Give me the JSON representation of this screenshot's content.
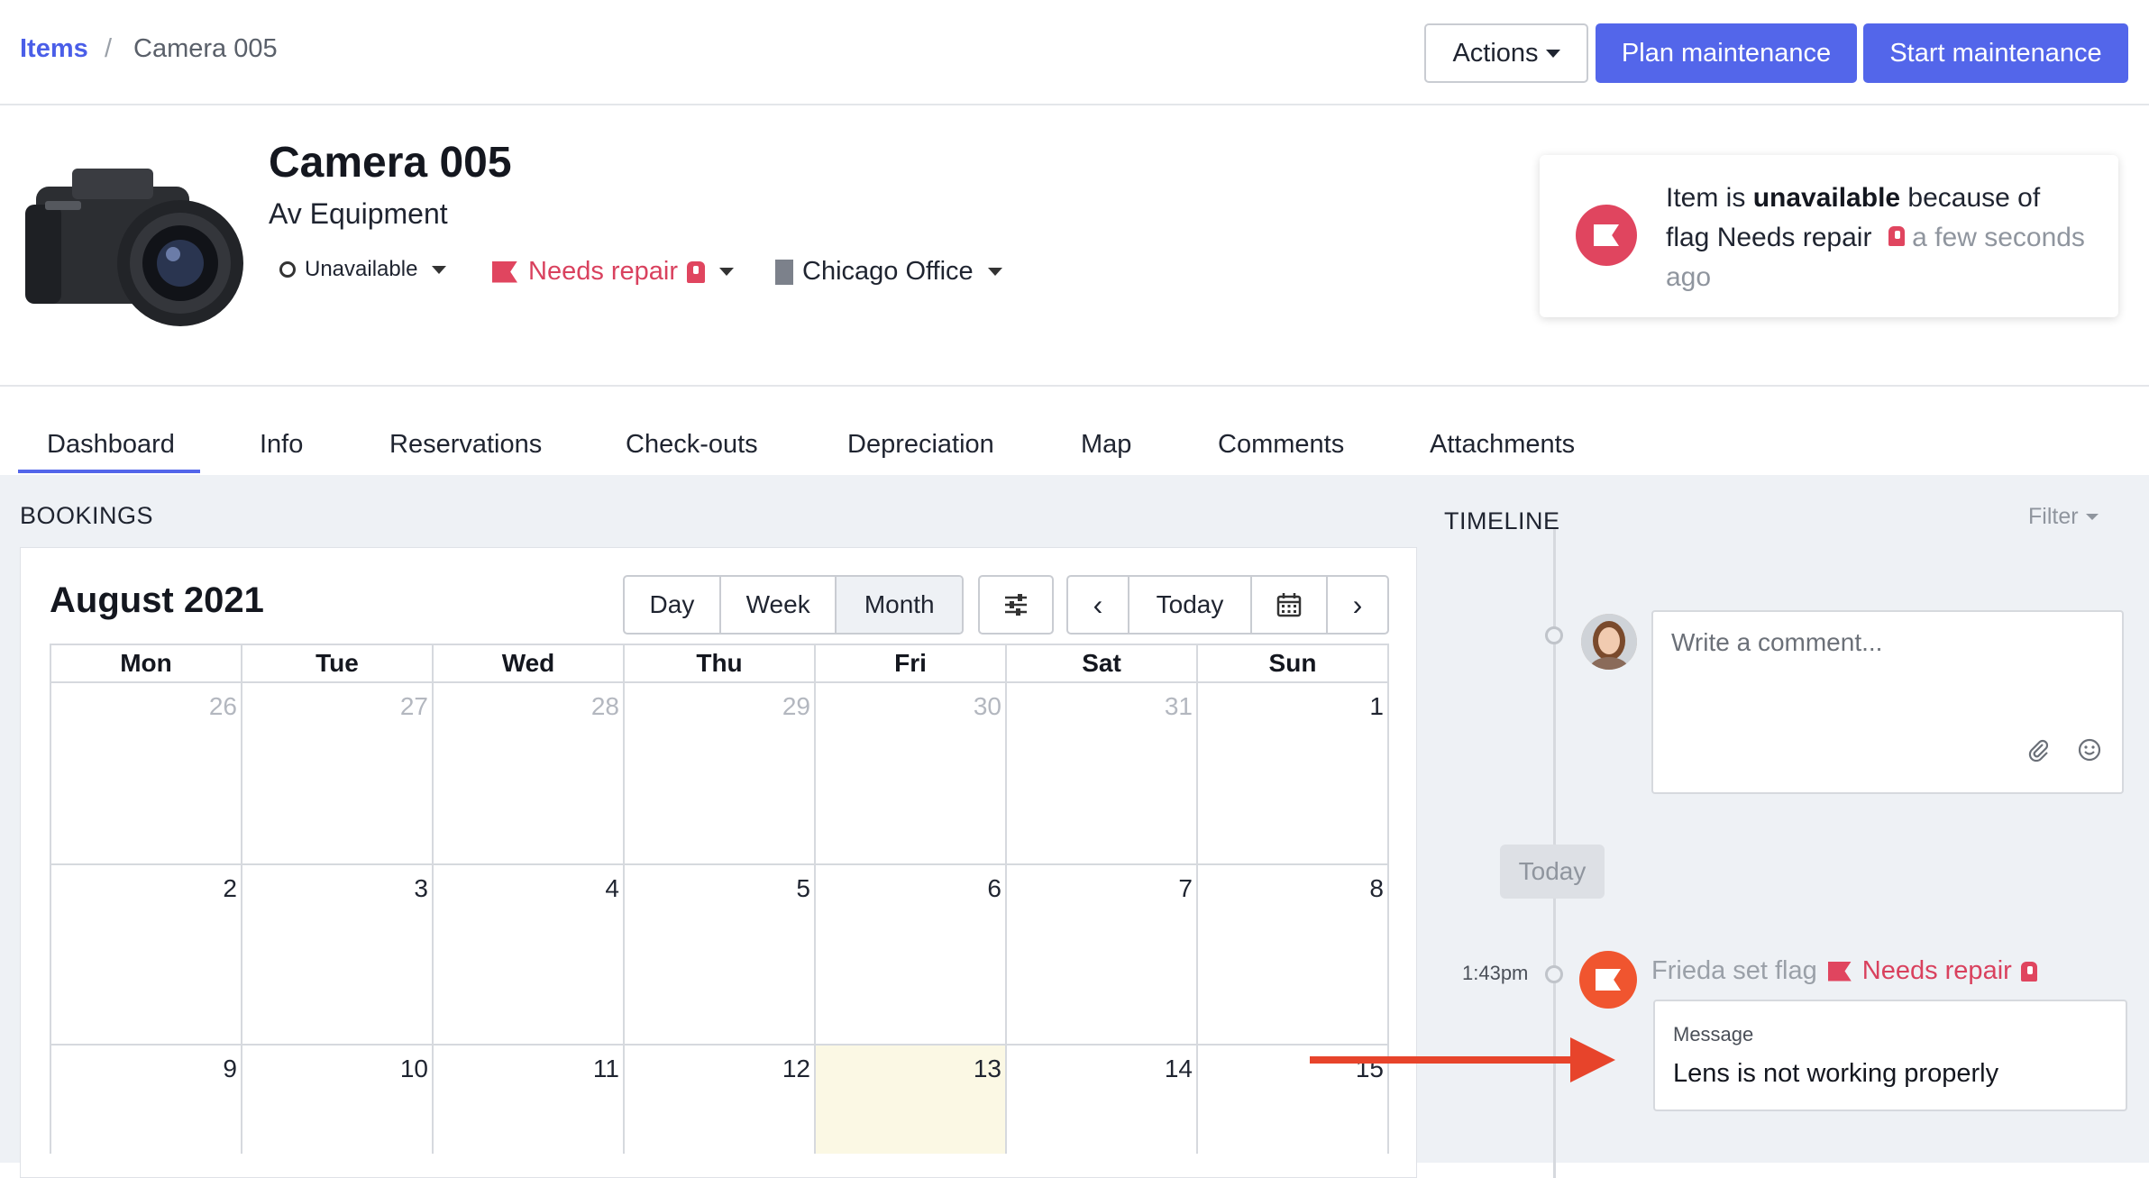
{
  "breadcrumb": {
    "root": "Items",
    "separator": "/",
    "current": "Camera 005"
  },
  "toolbar": {
    "actions_label": "Actions",
    "plan_label": "Plan maintenance",
    "start_label": "Start maintenance"
  },
  "item": {
    "name": "Camera 005",
    "category": "Av Equipment",
    "status": "Unavailable",
    "flag": "Needs repair",
    "location": "Chicago Office"
  },
  "notice": {
    "prefix": "Item is ",
    "bold": "unavailable",
    "mid": " because of flag Needs repair",
    "time": "a few seconds ago"
  },
  "tabs": [
    "Dashboard",
    "Info",
    "Reservations",
    "Check-outs",
    "Depreciation",
    "Map",
    "Comments",
    "Attachments"
  ],
  "bookings": {
    "label": "BOOKINGS",
    "month_title": "August 2021",
    "views": [
      "Day",
      "Week",
      "Month"
    ],
    "active_view": "Month",
    "nav": {
      "prev": "‹",
      "today": "Today",
      "next": "›"
    },
    "weekdays": [
      "Mon",
      "Tue",
      "Wed",
      "Thu",
      "Fri",
      "Sat",
      "Sun"
    ],
    "weeks": [
      [
        "26",
        "27",
        "28",
        "29",
        "30",
        "31",
        "1"
      ],
      [
        "2",
        "3",
        "4",
        "5",
        "6",
        "7",
        "8"
      ],
      [
        "9",
        "10",
        "11",
        "12",
        "13",
        "14",
        "15"
      ]
    ],
    "today_date": "13"
  },
  "timeline": {
    "label": "TIMELINE",
    "filter_label": "Filter",
    "comment_placeholder": "Write a comment...",
    "today_label": "Today",
    "event": {
      "time": "1:43pm",
      "text": "Frieda set flag",
      "flag": "Needs repair",
      "message_label": "Message",
      "message": "Lens is not working properly"
    }
  },
  "colors": {
    "accent": "#5366ea",
    "flag": "#e0455f",
    "event": "#f0552f",
    "arrow": "#e7442b"
  }
}
